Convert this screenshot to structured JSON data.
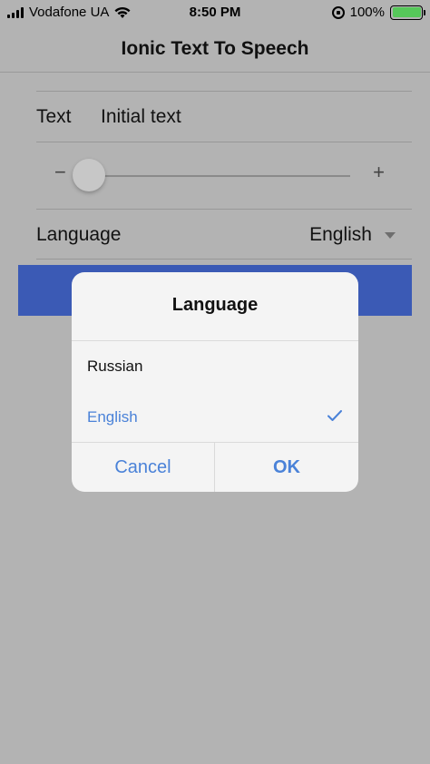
{
  "status_bar": {
    "carrier": "Vodafone UA",
    "time": "8:50 PM",
    "battery_percent": "100%",
    "battery_level": 1.0
  },
  "header": {
    "title": "Ionic Text To Speech"
  },
  "form": {
    "text_label": "Text",
    "text_value": "Initial text",
    "range_minus": "−",
    "range_plus": "+",
    "language_label": "Language",
    "language_value": "English"
  },
  "dialog": {
    "title": "Language",
    "options": [
      {
        "label": "Russian",
        "selected": false
      },
      {
        "label": "English",
        "selected": true
      }
    ],
    "cancel_label": "Cancel",
    "ok_label": "OK"
  },
  "colors": {
    "accent": "#4a82d8",
    "button": "#3b5ab5",
    "battery": "#56c85a"
  },
  "icons": {
    "signal": "cellular-signal-icon",
    "wifi": "wifi-icon",
    "rotation": "rotation-lock-icon",
    "battery": "battery-icon",
    "check": "checkmark-icon",
    "caret": "caret-down-icon"
  }
}
